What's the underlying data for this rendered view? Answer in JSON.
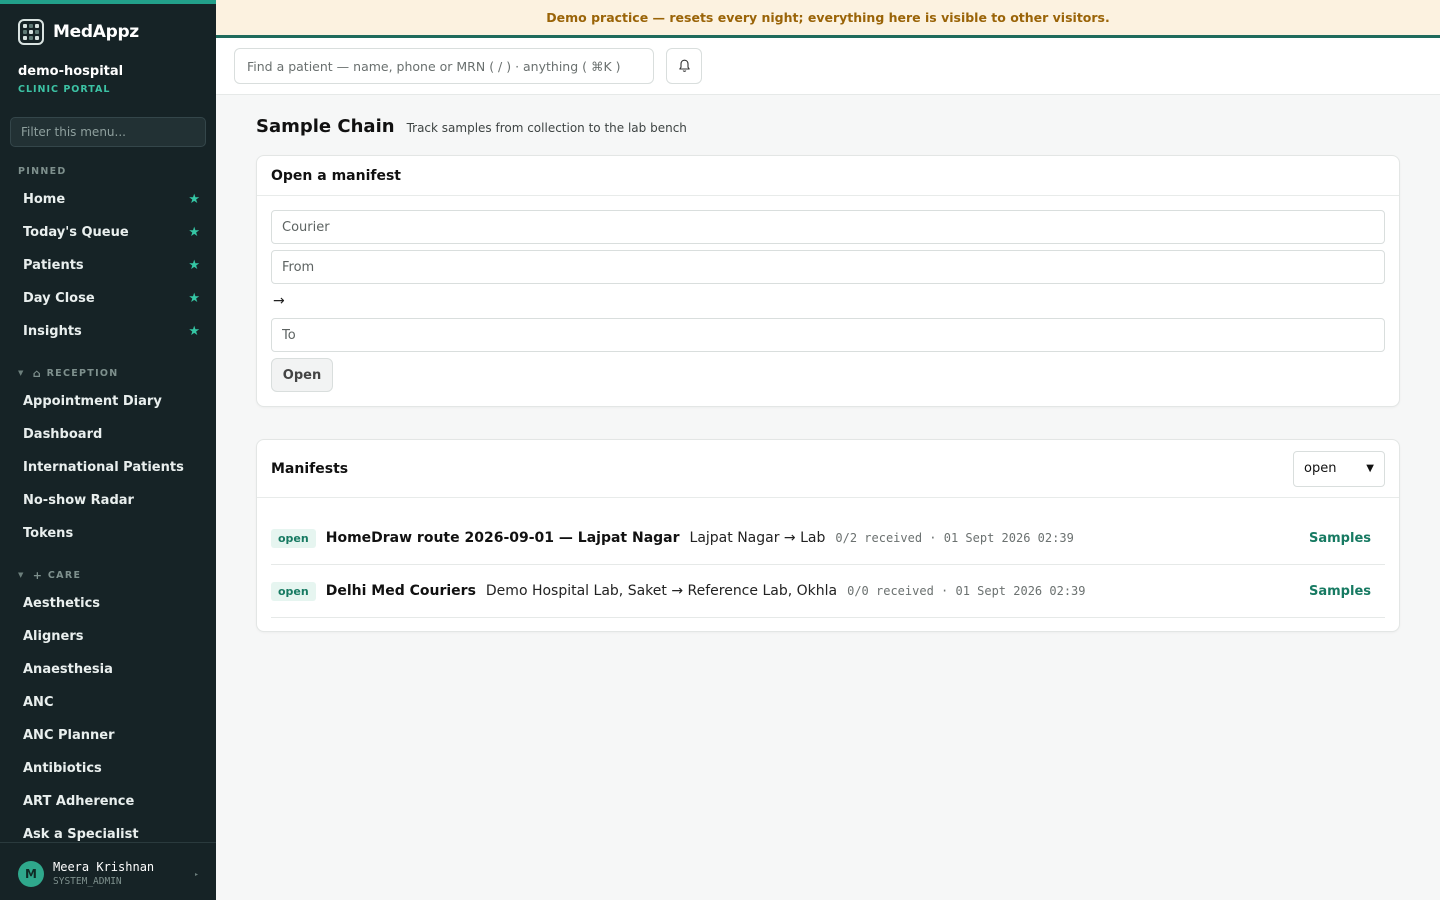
{
  "banner": {
    "text": "Demo practice — resets every night; everything here is visible to other visitors."
  },
  "brand": {
    "name": "MedAppz"
  },
  "org": {
    "name": "demo-hospital",
    "subtitle": "CLINIC PORTAL"
  },
  "menu_filter": {
    "placeholder": "Filter this menu..."
  },
  "pinned": {
    "label": "PINNED",
    "items": [
      {
        "label": "Home"
      },
      {
        "label": "Today's Queue"
      },
      {
        "label": "Patients"
      },
      {
        "label": "Day Close"
      },
      {
        "label": "Insights"
      }
    ]
  },
  "reception": {
    "label": "RECEPTION",
    "items": [
      {
        "label": "Appointment Diary"
      },
      {
        "label": "Dashboard"
      },
      {
        "label": "International Patients"
      },
      {
        "label": "No-show Radar"
      },
      {
        "label": "Tokens"
      }
    ]
  },
  "care": {
    "label": "CARE",
    "items": [
      {
        "label": "Aesthetics"
      },
      {
        "label": "Aligners"
      },
      {
        "label": "Anaesthesia"
      },
      {
        "label": "ANC"
      },
      {
        "label": "ANC Planner"
      },
      {
        "label": "Antibiotics"
      },
      {
        "label": "ART Adherence"
      },
      {
        "label": "Ask a Specialist"
      }
    ]
  },
  "user": {
    "initial": "M",
    "name": "Meera Krishnan",
    "role": "SYSTEM_ADMIN"
  },
  "topbar": {
    "search_placeholder": "Find a patient — name, phone or MRN ( / ) · anything ( ⌘K )"
  },
  "page": {
    "title": "Sample Chain",
    "subtitle": "Track samples from collection to the lab bench"
  },
  "manifest_form": {
    "title": "Open a manifest",
    "courier_placeholder": "Courier",
    "from_placeholder": "From",
    "arrow": "→",
    "to_placeholder": "To",
    "open_label": "Open"
  },
  "manifests": {
    "title": "Manifests",
    "filter_value": "open",
    "rows": [
      {
        "status": "open",
        "title": "HomeDraw route 2026-09-01 — Lajpat Nagar",
        "route": "Lajpat Nagar → Lab",
        "meta": "0/2 received · 01 Sept 2026 02:39",
        "action": "Samples"
      },
      {
        "status": "open",
        "title": "Delhi Med Couriers",
        "route": "Demo Hospital Lab, Saket → Reference Lab, Okhla",
        "meta": "0/0 received · 01 Sept 2026 02:39",
        "action": "Samples"
      }
    ]
  }
}
